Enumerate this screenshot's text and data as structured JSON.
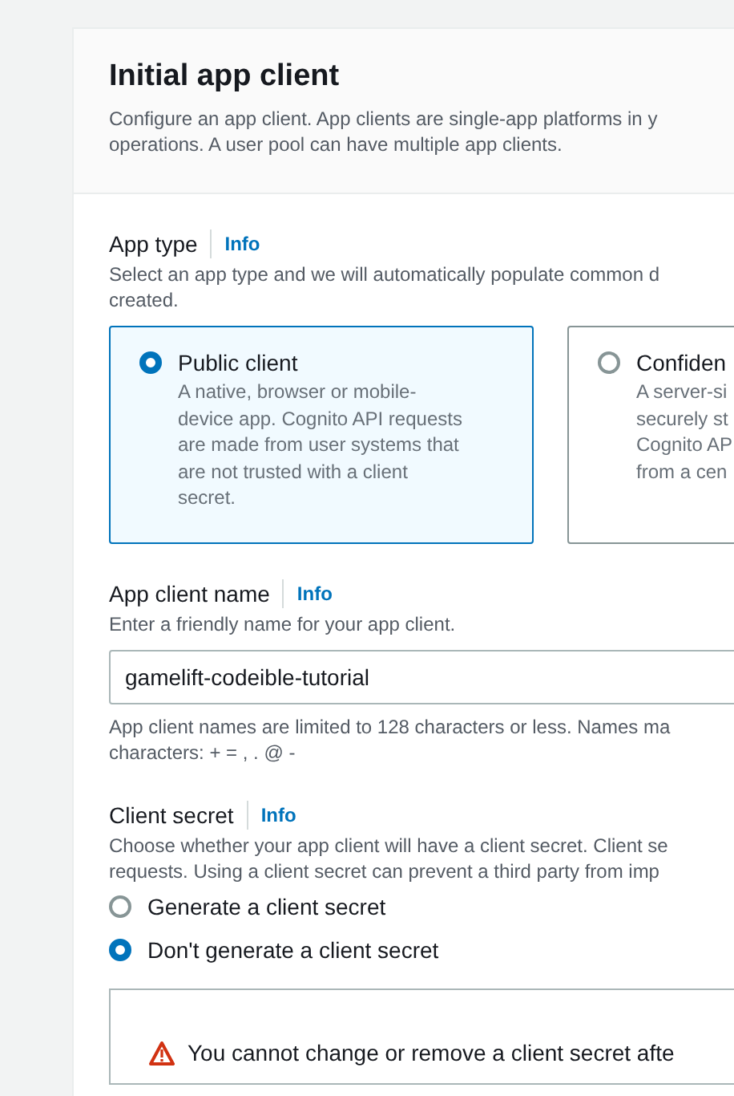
{
  "header": {
    "title": "Initial app client",
    "description": [
      "Configure an app client. App clients are single-app platforms in y",
      "operations. A user pool can have multiple app clients."
    ]
  },
  "app_type": {
    "label": "App type",
    "info": "Info",
    "description": [
      "Select an app type and we will automatically populate common d",
      "created."
    ],
    "options": [
      {
        "title": "Public client",
        "description": [
          "A native, browser or mobile-",
          "device app. Cognito API requests",
          "are made from user systems that",
          "are not trusted with a client",
          "secret."
        ],
        "selected": true
      },
      {
        "title": "Confiden",
        "description": [
          "A server-si",
          "securely st",
          "Cognito AP",
          "from a cen"
        ],
        "selected": false
      }
    ]
  },
  "app_client_name": {
    "label": "App client name",
    "info": "Info",
    "description": "Enter a friendly name for your app client.",
    "value": "gamelift-codeible-tutorial",
    "constraint": [
      "App client names are limited to 128 characters or less. Names ma",
      "characters: + = , . @ -"
    ]
  },
  "client_secret": {
    "label": "Client secret",
    "info": "Info",
    "description": [
      "Choose whether your app client will have a client secret. Client se",
      "requests. Using a client secret can prevent a third party from imp"
    ],
    "options": [
      {
        "label": "Generate a client secret",
        "selected": false
      },
      {
        "label": "Don't generate a client secret",
        "selected": true
      }
    ]
  },
  "alert": {
    "text": "You cannot change or remove a client secret afte"
  }
}
